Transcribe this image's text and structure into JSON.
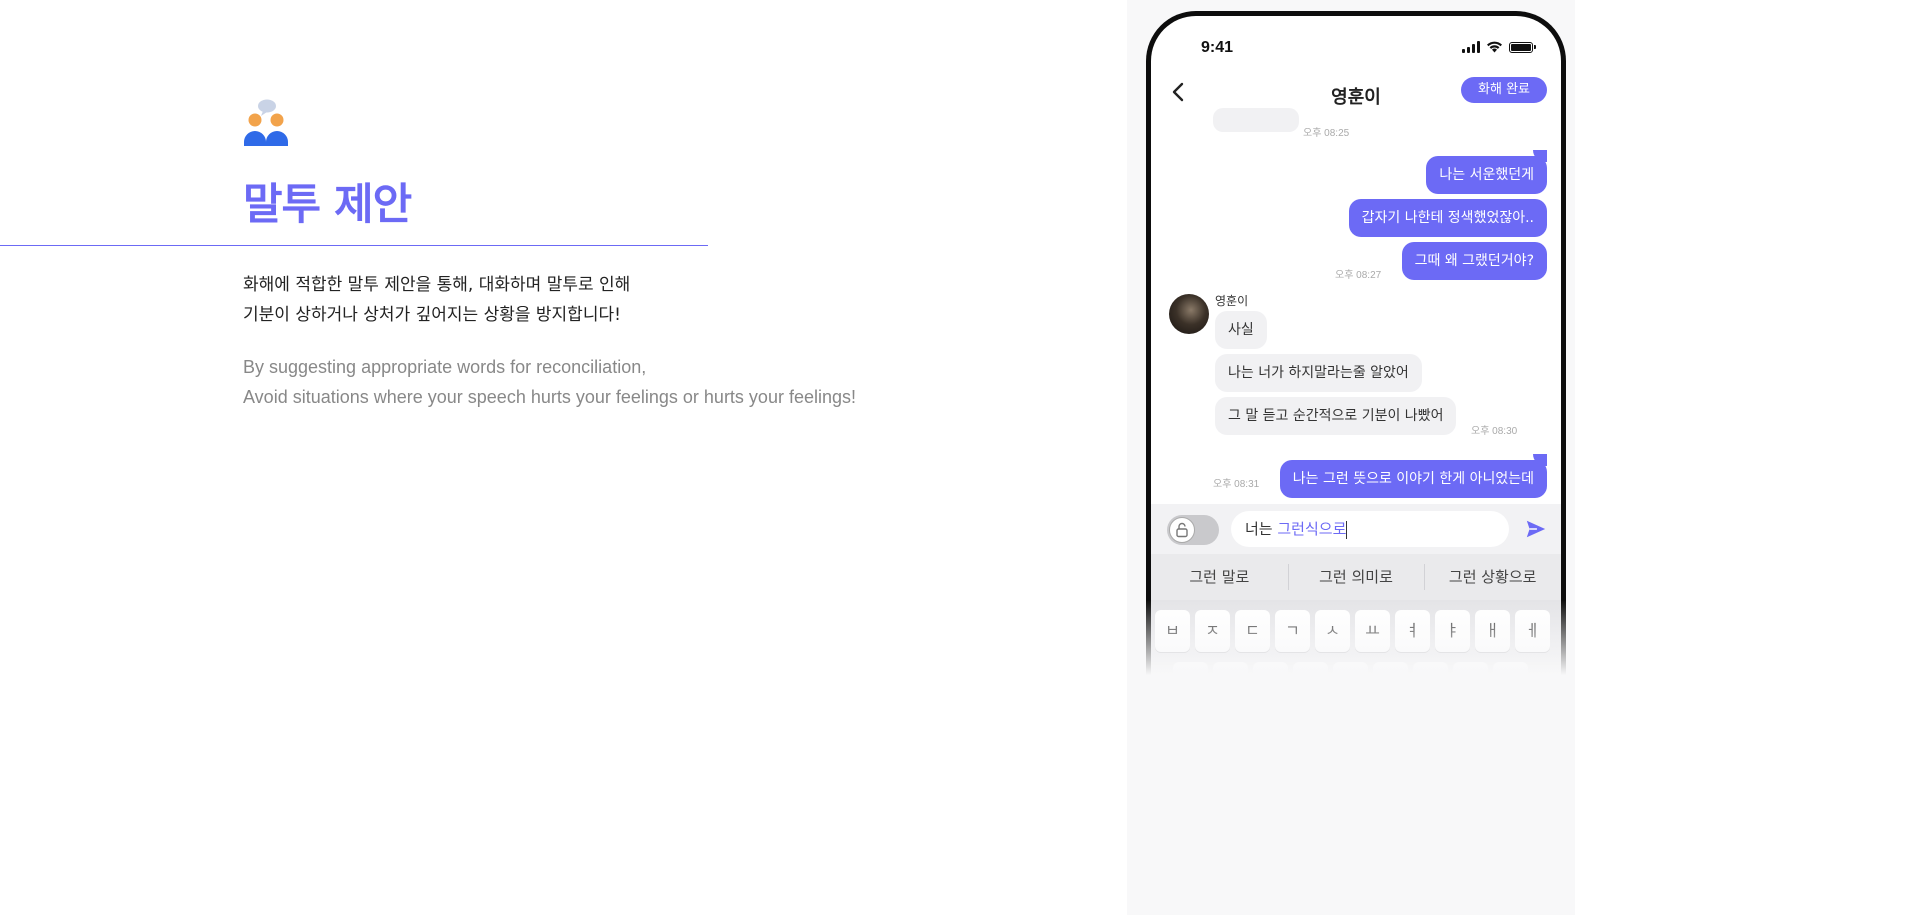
{
  "feature": {
    "title": "말투 제안",
    "icon": "people-speech-icon",
    "description_ko": [
      "화해에 적합한 말투 제안을 통해, 대화하며 말투로 인해",
      "기분이 상하거나 상처가 깊어지는 상황을 방지합니다!"
    ],
    "description_en": [
      "By suggesting appropriate words for reconciliation,",
      "Avoid situations where your speech hurts your feelings or hurts your feelings!"
    ]
  },
  "colors": {
    "accent": "#6c6af5",
    "bubble_other": "#f1f1f3",
    "input_bar": "#f2f2f4"
  },
  "phone": {
    "status_time": "9:41",
    "header": {
      "name": "영훈이",
      "done_label": "화해 완료",
      "back_icon": "chevron-left-icon"
    },
    "messages": {
      "ts_top": "오후 08:25",
      "me_group1": [
        "나는 서운했던게",
        "갑자기 나한테 정색했었잖아..",
        "그때 왜 그랬던거야?"
      ],
      "ts_me_group1": "오후 08:27",
      "sender_name": "영훈이",
      "them_group": [
        "사실",
        "나는 너가 하지말라는줄 알았어",
        "그 말 듣고 순간적으로 기분이 나빴어"
      ],
      "ts_them_group": "오후 08:30",
      "me_group2": [
        "나는 그런 뜻으로 이야기 한게 아니었는데"
      ],
      "ts_me_group2": "오후 08:31"
    },
    "input": {
      "typed_prefix": "너는 ",
      "typed_highlight": "그런식으로",
      "lock_icon": "unlock-icon",
      "send_icon": "send-icon"
    },
    "suggestions": [
      "그런 말로",
      "그런 의미로",
      "그런 상황으로"
    ],
    "keyboard_row1": [
      "ㅂ",
      "ㅈ",
      "ㄷ",
      "ㄱ",
      "ㅅ",
      "ㅛ",
      "ㅕ",
      "ㅑ",
      "ㅐ",
      "ㅔ"
    ]
  }
}
